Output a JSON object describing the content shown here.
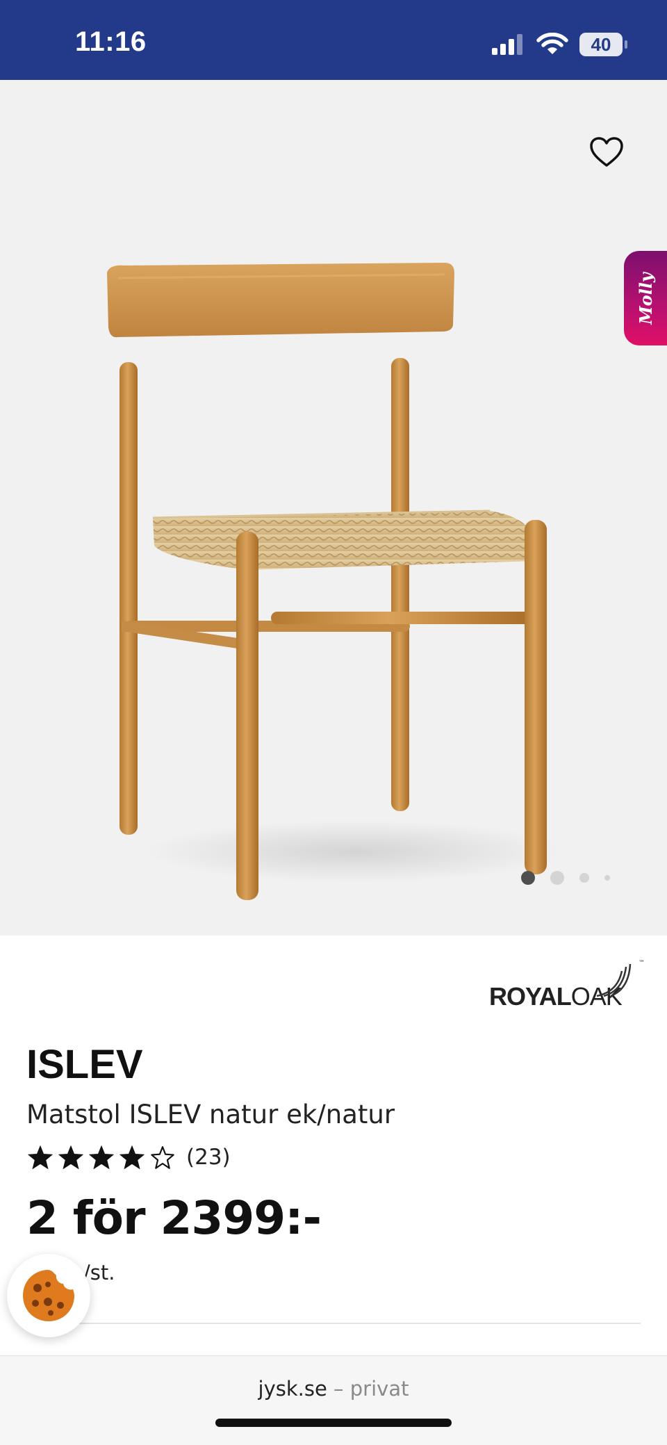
{
  "status_bar": {
    "time": "11:16",
    "battery": "40",
    "background": "#233a8b"
  },
  "gallery": {
    "favorite_icon": "heart-outline-icon",
    "molly_label": "Molly",
    "image_count": 4,
    "active_image": 1
  },
  "product": {
    "brand": {
      "part1": "ROYAL",
      "part2": "OAK",
      "trademark": "™"
    },
    "name": "ISLEV",
    "subtitle": "Matstol ISLEV natur ek/natur",
    "rating": {
      "stars_filled": 4,
      "stars_total": 5,
      "count": "(23)"
    },
    "price": "2 för 2399:-",
    "unit_price_suffix": "/st."
  },
  "cookie_button": {
    "icon": "cookie-icon"
  },
  "browser": {
    "domain": "jysk.se",
    "separator": " – privat"
  }
}
